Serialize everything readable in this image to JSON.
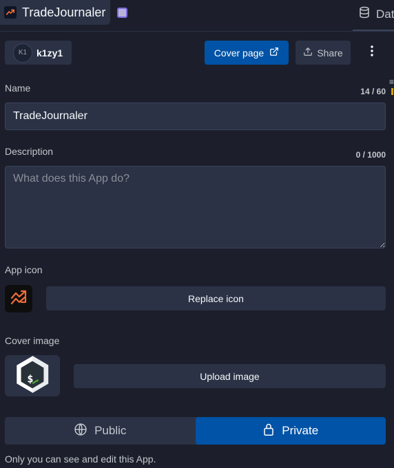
{
  "tabs": {
    "app_title": "TradeJournaler",
    "database_label": "Dat"
  },
  "owner": {
    "initials": "K1",
    "username": "k1zy1"
  },
  "actions": {
    "cover_page": "Cover page",
    "share": "Share"
  },
  "form": {
    "name_label": "Name",
    "name_counter": "14 / 60",
    "name_value": "TradeJournaler",
    "description_label": "Description",
    "description_counter": "0 / 1000",
    "description_placeholder": "What does this App do?",
    "app_icon_label": "App icon",
    "replace_icon": "Replace icon",
    "cover_image_label": "Cover image",
    "upload_image": "Upload image"
  },
  "visibility": {
    "public": "Public",
    "private": "Private",
    "selected": "private",
    "note": "Only you can see and edit this App."
  },
  "icons": {
    "app_tab": "trending-up-icon",
    "database": "database-icon",
    "external": "external-link-icon",
    "share": "upload-icon",
    "more": "vertical-dots-icon",
    "globe": "globe-icon",
    "lock": "lock-icon",
    "cover": "bash-shell-icon"
  },
  "colors": {
    "background": "#1c1f2b",
    "surface": "#2b3245",
    "accent": "#0053a6",
    "icon_orange": "#f26c3a"
  }
}
